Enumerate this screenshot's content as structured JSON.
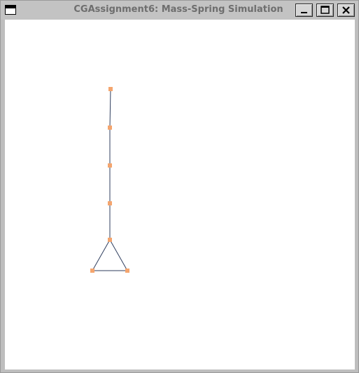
{
  "window": {
    "title": "CGAssignment6: Mass-Spring Simulation"
  },
  "icons": {
    "window_menu": "window-menu-icon",
    "minimize": "minimize-icon",
    "maximize": "maximize-icon",
    "close": "close-icon"
  },
  "colors": {
    "mass_point": "#f4a56e",
    "spring_line": "#2f3e5e",
    "canvas_background": "#ffffff",
    "title_text": "#6e6e6e"
  }
}
